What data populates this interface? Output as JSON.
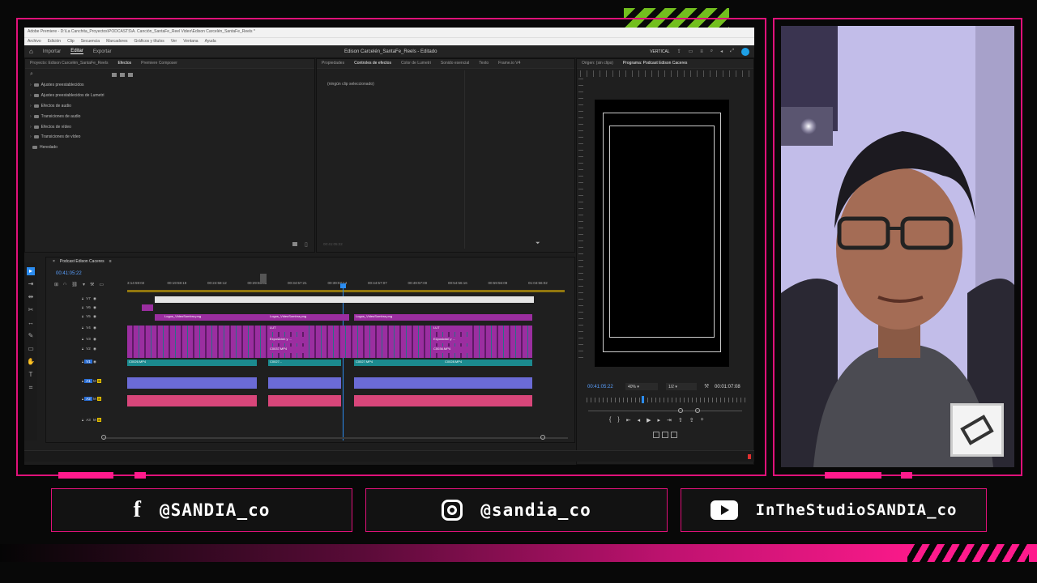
{
  "app": {
    "window_title": "Adobe Premiere - D:\\La Canchita_Proyectos\\PODCASTS\\A. Canción_SantaFe_Reel Video\\Edison Carcelén_SantaFe_Reels *",
    "menu": [
      "Archivo",
      "Edición",
      "Clip",
      "Secuencia",
      "Marcadores",
      "Gráficos y títulos",
      "Ver",
      "Ventana",
      "Ayuda"
    ],
    "workspace_tabs": [
      "Importar",
      "Editar",
      "Exportar"
    ],
    "active_workspace": "Editar",
    "project_title": "Edison Carcelén_SantaFe_Reels - Editado",
    "vertical_label": "VERTICAL"
  },
  "project_panel": {
    "tabs": [
      "Proyecto: Edison Carcelén_SantaFe_Reels",
      "Efectos",
      "Premiere Composer"
    ],
    "active_tab": "Efectos",
    "items": [
      "Ajustes preestablecidos",
      "Ajustes preestablecidos de Lumetri",
      "Efectos de audio",
      "Transiciones de audio",
      "Efectos de vídeo",
      "Transiciones de vídeo",
      "Heredado"
    ]
  },
  "effects_panel": {
    "tabs": [
      "Propiedades",
      "Controles de efectos",
      "Color de Lumetri",
      "Sonido esencial",
      "Texto",
      "Frame.io V4"
    ],
    "active_tab": "Controles de efectos",
    "empty_message": "(ningún clip seleccionado)",
    "timecode": "00:41:05:22"
  },
  "monitor": {
    "tabs": [
      "Origen: (sin clips)",
      "Programa: Podcast Edison Caceres"
    ],
    "active_tab": "Programa: Podcast Edison Caceres",
    "timecode": "00:41:05:22",
    "zoom": "40%",
    "resolution": "1/2",
    "duration": "00:01:07:08"
  },
  "timeline": {
    "sequence_name": "Podcast Edison Caceres",
    "timecode": "00:41:05:22",
    "ruler": [
      "3:14:59:02",
      "00:19:58:19",
      "00:24:58:12",
      "00:29:58:05",
      "00:34:57:21",
      "00:39:57:14",
      "00:44:57:07",
      "00:49:57:00",
      "00:54:56:16",
      "00:59:56:09",
      "01:04:56:02"
    ],
    "tracks": [
      "V7",
      "V6",
      "V5",
      "V4",
      "V3",
      "V2",
      "V1",
      "A1",
      "A2",
      "A3"
    ],
    "clip_labels": {
      "logo1": "Logos_VideoSombra.png",
      "logo2": "Logos_VideoSombra.png",
      "logo3": "Logos_VideoSombra.png",
      "lut1": "LUT",
      "lut2": "LUT",
      "expo1": "Exposición y ...",
      "expo2": "Exposición y ...",
      "c1": "C0037.MP4",
      "c2": "C0036.MP4",
      "v1a": "C0026.MP4",
      "v1b": "C0027...",
      "v1c": "C0027.MP4",
      "v1d": "C0028.MP4"
    }
  },
  "social": {
    "facebook": "@SANDIA_co",
    "instagram": "@sandia_co",
    "youtube": "InTheStudioSANDIA_co"
  },
  "colors": {
    "accent": "#e0117a",
    "green": "#7ed321",
    "premiere_blue": "#2b8cf0"
  }
}
